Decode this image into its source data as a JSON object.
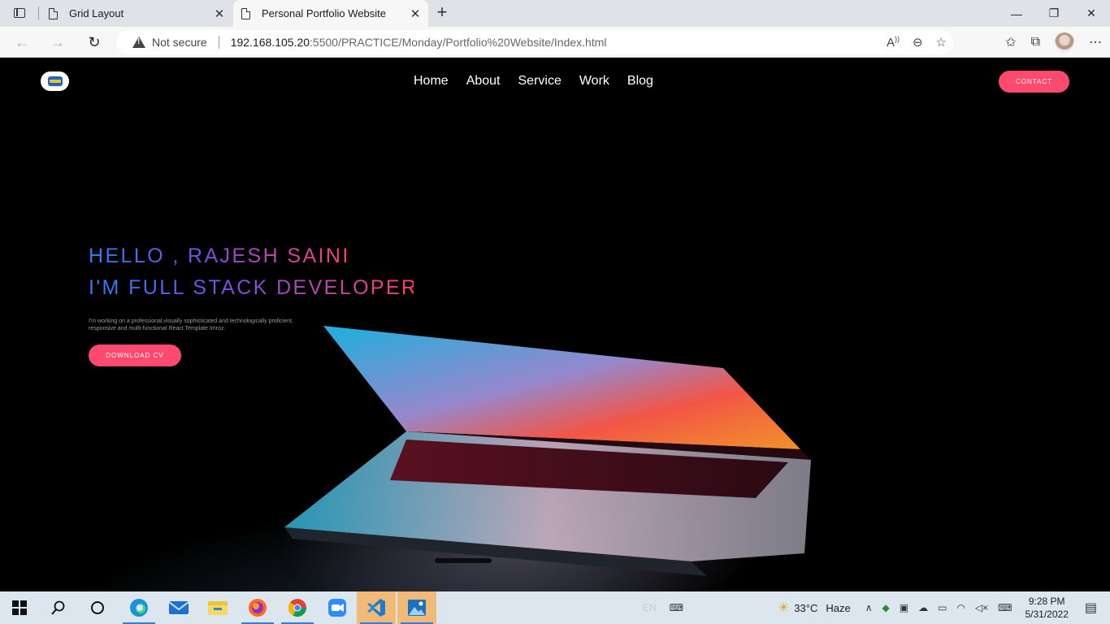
{
  "browser": {
    "tabs": [
      {
        "title": "Grid Layout",
        "active": false
      },
      {
        "title": "Personal Portfolio Website",
        "active": true
      }
    ],
    "address": {
      "security_label": "Not secure",
      "url_host": "192.168.105.20",
      "url_path": ":5500/PRACTICE/Monday/Portfolio%20Website/Index.html"
    }
  },
  "site": {
    "nav": [
      "Home",
      "About",
      "Service",
      "Work",
      "Blog"
    ],
    "contact_label": "CONTACT",
    "hero": {
      "line1": "HELLO , RAJESH SAINI",
      "line2": "I'M FULL STACK DEVELOPER",
      "intro": "I'm working on a professional,visually sophisticated and technologically proficient, responsive and multi-functional React Template Imroz.",
      "download_label": "DOWNLOAD CV"
    },
    "colors": {
      "accent": "#ff4a6e",
      "gradient_start": "#2a7ef5",
      "gradient_mid": "#7a4ee0",
      "gradient_end": "#ff3f6b"
    }
  },
  "taskbar": {
    "apps": [
      "start-icon",
      "search-icon",
      "task-view-icon",
      "edge-icon",
      "mail-icon",
      "file-explorer-icon",
      "firefox-icon",
      "chrome-icon",
      "zoom-icon",
      "vscode-icon",
      "photos-icon"
    ],
    "language": "EN",
    "weather": {
      "temp": "33°C",
      "condition": "Haze"
    },
    "time": "9:28 PM",
    "date": "5/31/2022"
  }
}
